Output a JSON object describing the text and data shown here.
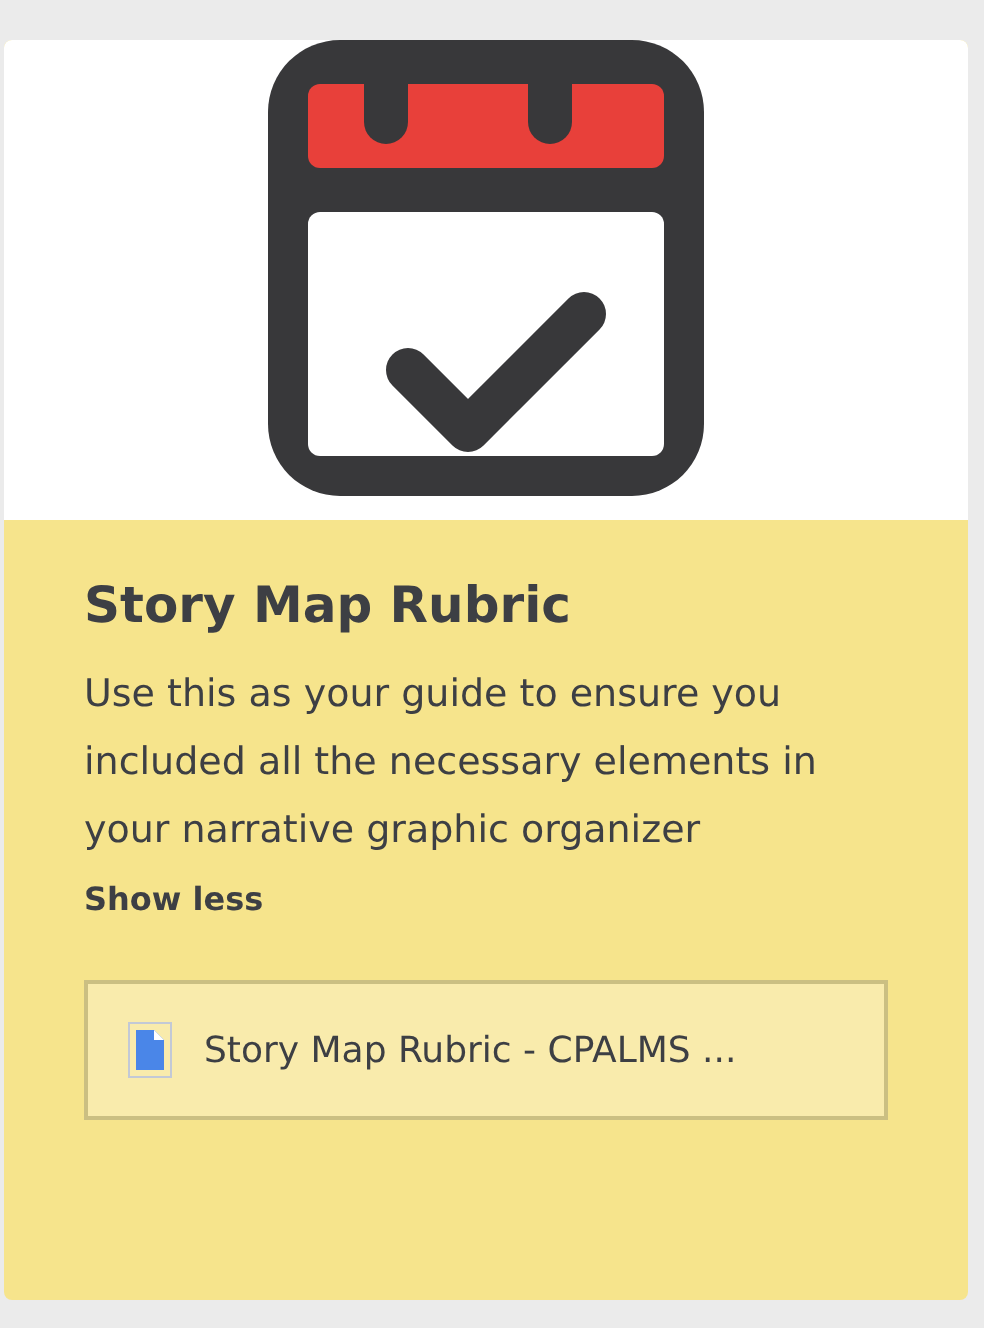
{
  "card": {
    "title": "Story Map Rubric",
    "description": "Use this as your guide to ensure you included all the necessary elements in your narrative graphic organizer",
    "toggle": "Show less",
    "attachment": {
      "name": "Story Map Rubric - CPALMS ..."
    }
  }
}
